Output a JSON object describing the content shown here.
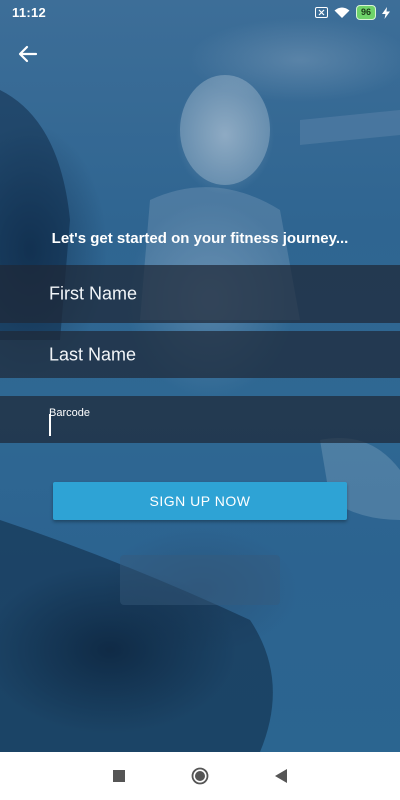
{
  "status_bar": {
    "time": "11:12",
    "battery_level": "96",
    "icons": [
      "sim-x-icon",
      "wifi-icon",
      "battery-icon",
      "charging-icon"
    ]
  },
  "header": {
    "back_icon": "back-arrow-icon"
  },
  "form": {
    "heading": "Let's get started on your fitness journey...",
    "first_name": {
      "placeholder": "First Name",
      "value": ""
    },
    "last_name": {
      "placeholder": "Last Name",
      "value": ""
    },
    "barcode": {
      "label": "Barcode",
      "value": ""
    },
    "submit_label": "SIGN UP NOW"
  },
  "colors": {
    "overlay": "#2f6591",
    "field_background": "#1e2837",
    "button": "#2ea3d5",
    "text": "#ffffff"
  },
  "nav_bar": {
    "icons": [
      "recent-apps-icon",
      "home-icon",
      "back-triangle-icon"
    ]
  }
}
